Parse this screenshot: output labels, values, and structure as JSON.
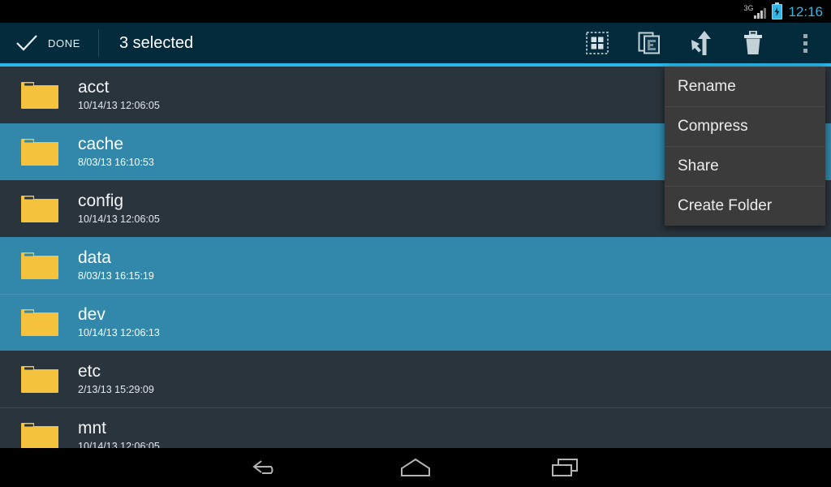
{
  "status_bar": {
    "network_label": "3G",
    "signal_icon": "signal-bars-icon",
    "battery_icon": "battery-charging-icon",
    "clock": "12:16",
    "clock_color": "#33b5e5"
  },
  "action_bar": {
    "done_icon": "check-icon",
    "done_label": "DONE",
    "title": "3 selected",
    "accent_color": "#29b6e8",
    "background_color": "#042b3c",
    "actions": [
      {
        "name": "select-all-icon",
        "label": "Select All"
      },
      {
        "name": "copy-icon",
        "label": "Copy"
      },
      {
        "name": "move-icon",
        "label": "Move"
      },
      {
        "name": "delete-icon",
        "label": "Delete"
      },
      {
        "name": "overflow-menu-icon",
        "label": "More options"
      }
    ]
  },
  "popup_menu": {
    "background_color": "#3b3b3b",
    "items": [
      {
        "label": "Rename"
      },
      {
        "label": "Compress"
      },
      {
        "label": "Share"
      },
      {
        "label": "Create Folder"
      }
    ]
  },
  "file_list": {
    "row_color": "#2a343c",
    "selected_row_color": "#3188ab",
    "folder_color": "#f5c23e",
    "rows": [
      {
        "name": "acct",
        "date": "10/14/13 12:06:05",
        "selected": false
      },
      {
        "name": "cache",
        "date": "8/03/13 16:10:53",
        "selected": true
      },
      {
        "name": "config",
        "date": "10/14/13 12:06:05",
        "selected": false
      },
      {
        "name": "data",
        "date": "8/03/13 16:15:19",
        "selected": true
      },
      {
        "name": "dev",
        "date": "10/14/13 12:06:13",
        "selected": true
      },
      {
        "name": "etc",
        "date": "2/13/13 15:29:09",
        "selected": false
      },
      {
        "name": "mnt",
        "date": "10/14/13 12:06:05",
        "selected": false
      }
    ]
  },
  "nav_bar": {
    "buttons": [
      {
        "name": "back-icon",
        "label": "Back"
      },
      {
        "name": "home-icon",
        "label": "Home"
      },
      {
        "name": "recents-icon",
        "label": "Recent apps"
      }
    ]
  }
}
